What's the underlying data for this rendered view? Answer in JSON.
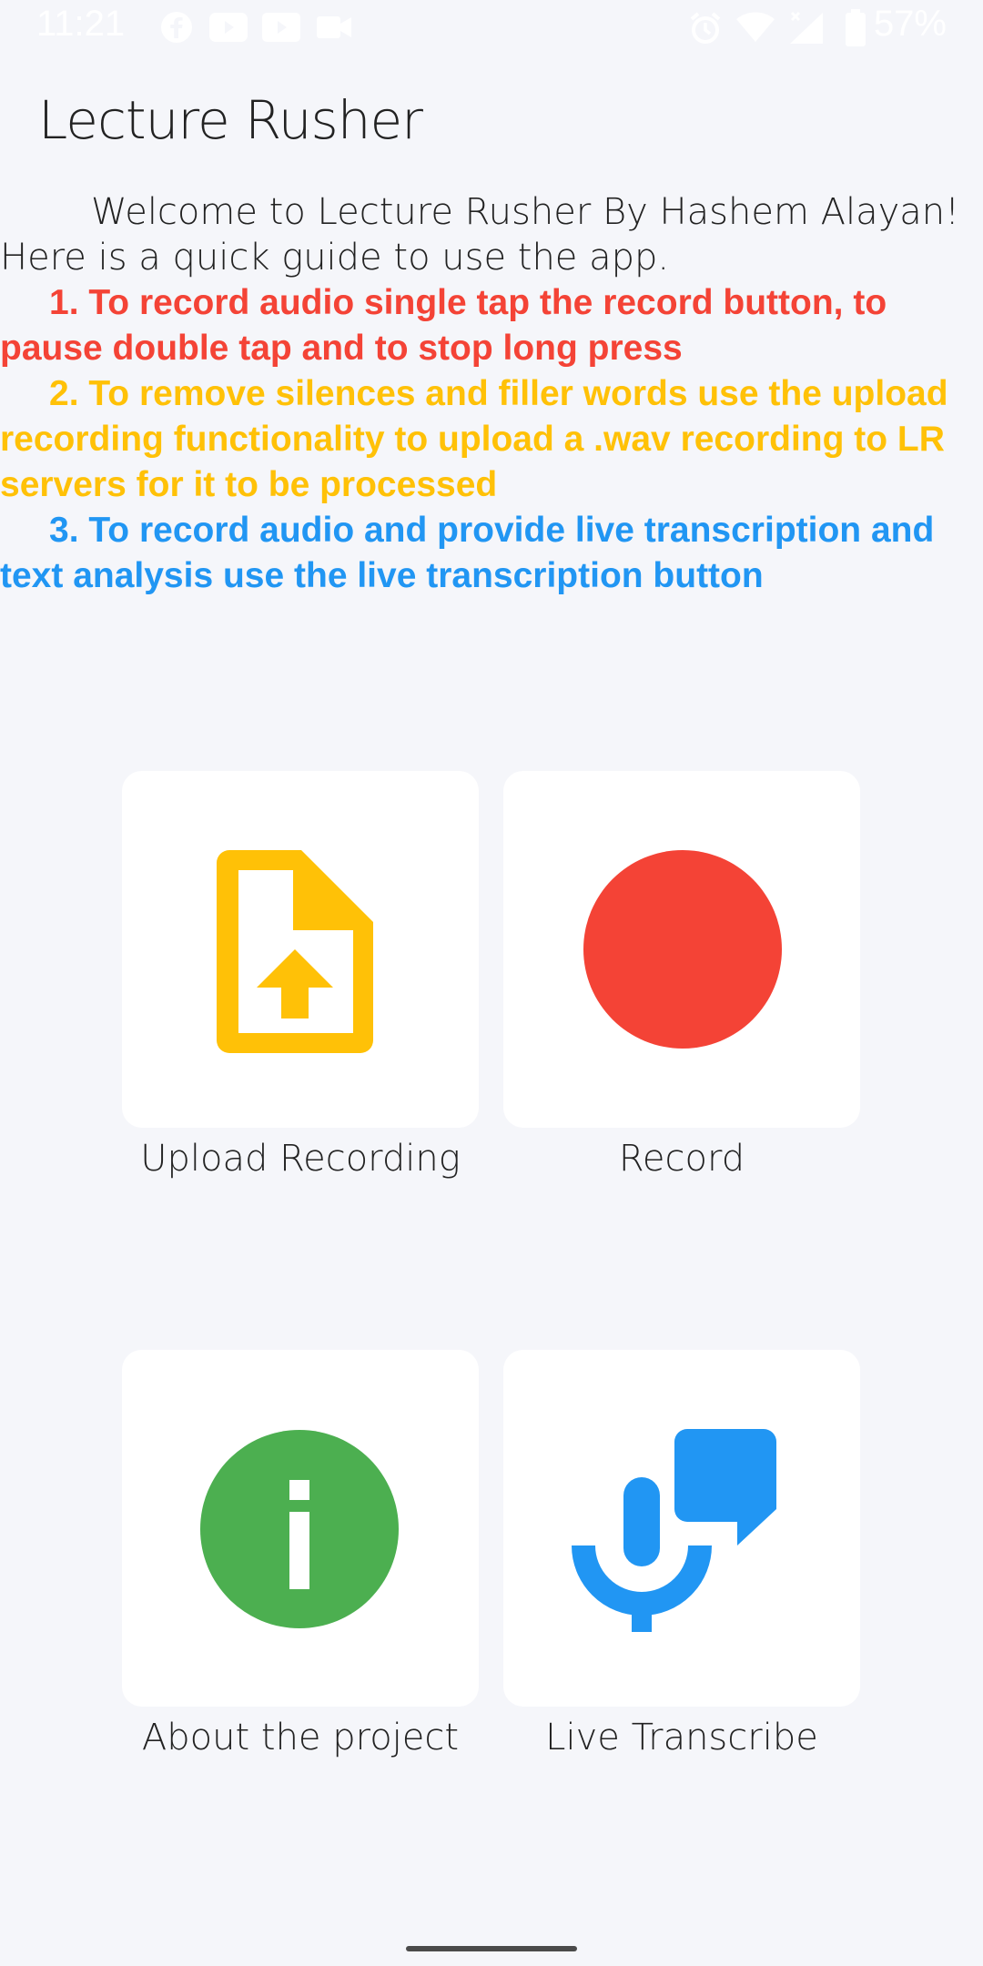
{
  "status_bar": {
    "time": "11:21",
    "battery": "57%"
  },
  "app_title": "Lecture Rusher",
  "guide": {
    "welcome": "Welcome to Lecture Rusher By Hashem Alayan! Here is a quick guide to use the app.",
    "steps": [
      {
        "text": "1. To record audio single tap the record button, to pause double tap and to stop long press",
        "color": "#f44336"
      },
      {
        "text": "2. To remove silences and filler words use the upload recording functionality to upload a .wav recording to LR servers for it to be processed",
        "color": "#ffc107"
      },
      {
        "text": "3. To record audio and provide live transcription and text analysis use the live transcription button",
        "color": "#2196f3"
      }
    ]
  },
  "tiles": [
    {
      "label": "Upload Recording",
      "icon": "file-upload-icon",
      "color": "#ffc107"
    },
    {
      "label": "Record",
      "icon": "record-circle-icon",
      "color": "#f44336"
    },
    {
      "label": "About the project",
      "icon": "info-icon",
      "color": "#4caf50"
    },
    {
      "label": "Live Transcribe",
      "icon": "mic-speech-icon",
      "color": "#2196f3"
    }
  ]
}
